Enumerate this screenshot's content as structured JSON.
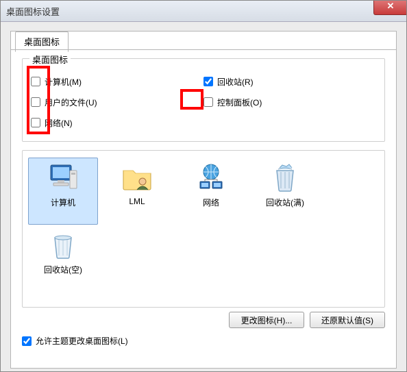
{
  "window": {
    "title": "桌面图标设置"
  },
  "tab": {
    "label": "桌面图标"
  },
  "group": {
    "legend": "桌面图标",
    "checks": {
      "computer": {
        "label": "计算机(M)",
        "checked": false
      },
      "userfiles": {
        "label": "用户的文件(U)",
        "checked": false
      },
      "network": {
        "label": "网络(N)",
        "checked": false
      },
      "recyclebin": {
        "label": "回收站(R)",
        "checked": true
      },
      "controlpanel": {
        "label": "控制面板(O)",
        "checked": false
      }
    }
  },
  "icons": {
    "computer": "计算机",
    "userfolder": "LML",
    "network": "网络",
    "recyclebin_full": "回收站(满)",
    "recyclebin_empty": "回收站(空)"
  },
  "buttons": {
    "change_icon": "更改图标(H)...",
    "restore_default": "还原默认值(S)"
  },
  "footer": {
    "allow_theme_label": "允许主题更改桌面图标(L)",
    "allow_theme_checked": true
  },
  "close_glyph": "✕"
}
